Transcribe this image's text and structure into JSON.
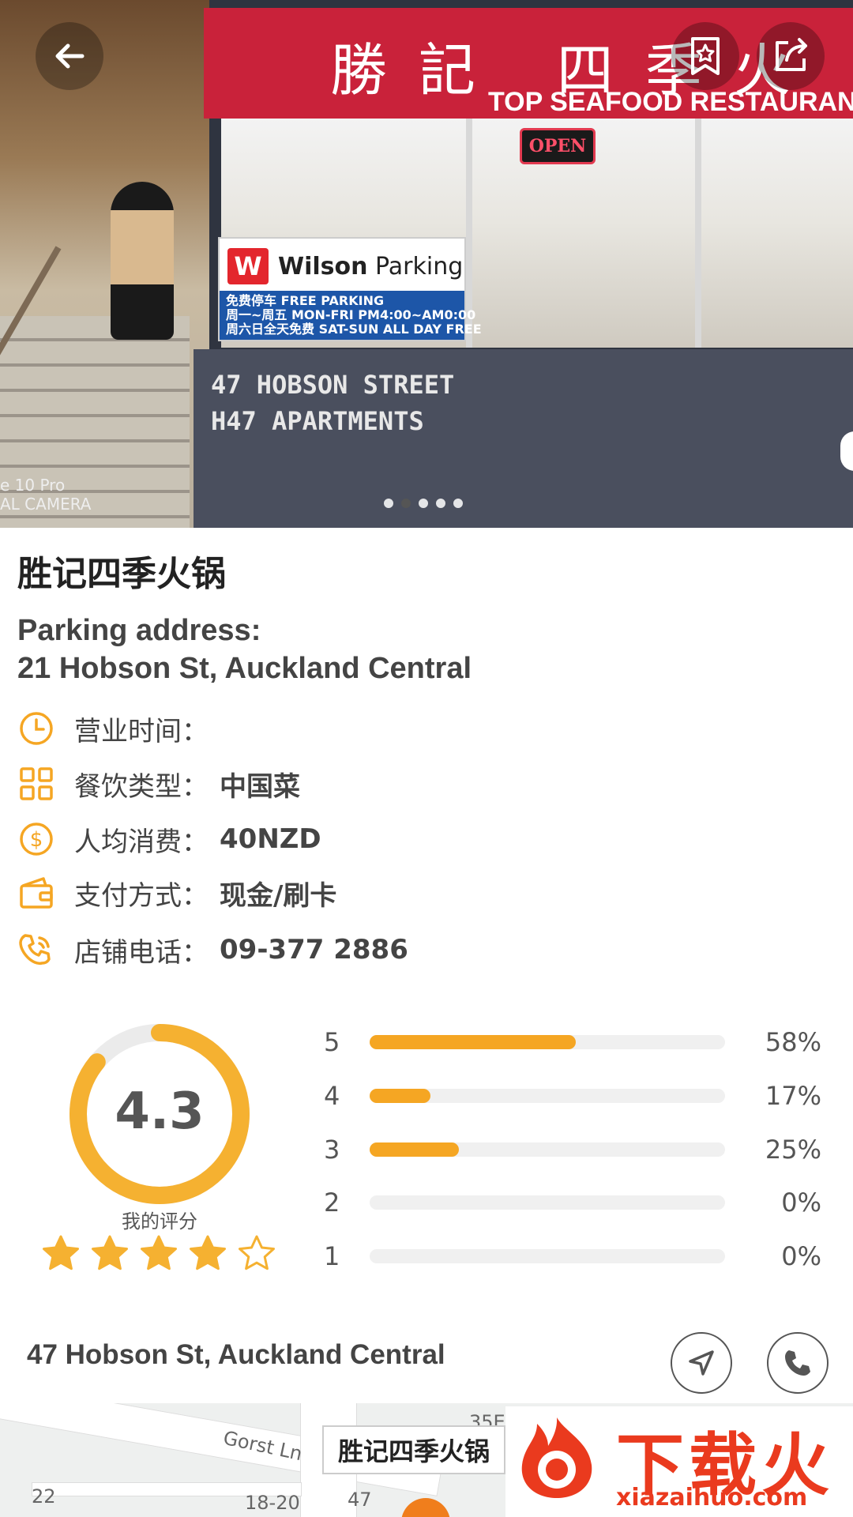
{
  "hero": {
    "banner_cn": "勝記 四季火鍋",
    "banner_en": "TOP SEAFOOD RESTAURANT",
    "open_sign": "OPEN",
    "wilson_name_bold": "Wilson",
    "wilson_name_rest": " Parking",
    "wilson_logo": "W",
    "wilson_line1": "免费停车 FREE PARKING",
    "wilson_line2": "周一~周五 MON-FRI PM4:00~AM0:00",
    "wilson_line3": "周六日全天免费 SAT-SUN ALL DAY FREE",
    "wall_text": "47 HOBSON STREET\nH47 APARTMENTS",
    "camera_text": "e 10 Pro\nAL CAMERA",
    "image_count": 5,
    "current_image": 2
  },
  "header": {
    "back_icon": "arrow-left-icon",
    "bookmark_icon": "bookmark-star-icon",
    "share_icon": "share-icon"
  },
  "restaurant": {
    "name": "胜记四季火锅",
    "parking_label": "Parking address:",
    "parking_address": "21 Hobson St, Auckland Central",
    "details": [
      {
        "icon": "clock-icon",
        "label": "营业时间：",
        "value": ""
      },
      {
        "icon": "grid-icon",
        "label": "餐饮类型：",
        "value": "中国菜"
      },
      {
        "icon": "dollar-icon",
        "label": "人均消费：",
        "value": "40NZD"
      },
      {
        "icon": "wallet-icon",
        "label": "支付方式：",
        "value": "现金/刷卡"
      },
      {
        "icon": "phone-icon",
        "label": "店铺电话：",
        "value": "09-377 2886"
      }
    ]
  },
  "rating": {
    "score": "4.3",
    "score_fraction": 0.86,
    "my_rating_label": "我的评分",
    "stars_filled": 4,
    "stars_total": 5,
    "distribution": [
      {
        "stars": "5",
        "pct": "58%",
        "fraction": 0.58
      },
      {
        "stars": "4",
        "pct": "17%",
        "fraction": 0.17
      },
      {
        "stars": "3",
        "pct": "25%",
        "fraction": 0.25
      },
      {
        "stars": "2",
        "pct": "0%",
        "fraction": 0.0
      },
      {
        "stars": "1",
        "pct": "0%",
        "fraction": 0.0
      }
    ]
  },
  "location": {
    "address": "47 Hobson St, Auckland Central",
    "navigate_icon": "navigate-icon",
    "call_icon": "phone-icon"
  },
  "map": {
    "callout": "胜记四季火锅",
    "labels": {
      "gorst": "Gorst Ln",
      "n35": "35E",
      "n22": "22",
      "n1820": "18-20",
      "n47": "47"
    }
  },
  "watermark": {
    "cn": "下载火",
    "en": "xiazaihuo.com"
  },
  "colors": {
    "accent": "#f5a623",
    "brand_red": "#c9223a",
    "text": "#444444"
  }
}
